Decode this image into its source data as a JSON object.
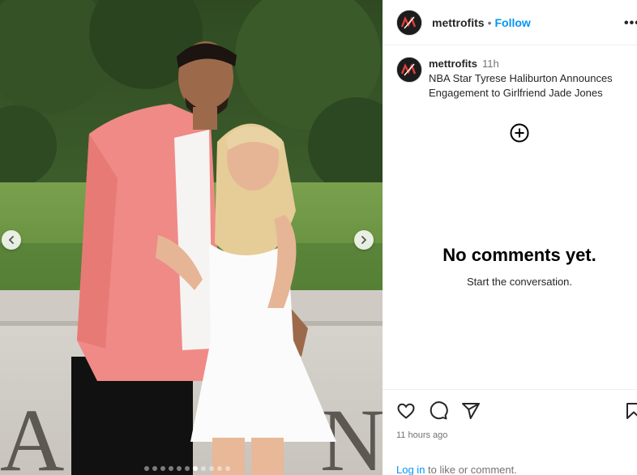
{
  "post": {
    "username": "mettrofits",
    "follow_label": "Follow",
    "separator": "•",
    "more_label": "•••"
  },
  "caption": {
    "username": "mettrofits",
    "time": "11h",
    "text": "NBA Star Tyrese Haliburton Announces Engagement to Girlfriend Jade Jones"
  },
  "comments": {
    "empty_title": "No comments yet.",
    "empty_subtitle": "Start the conversation."
  },
  "footer": {
    "timestamp": "11 hours ago",
    "login_link": "Log in",
    "login_suffix": " to like or comment."
  },
  "carousel": {
    "slide_count": 11,
    "active_index": 6
  },
  "icons": {
    "like": "heart-icon",
    "comment": "comment-icon",
    "share": "share-icon",
    "save": "bookmark-icon",
    "add": "plus-circle-icon",
    "prev": "chevron-left-icon",
    "next": "chevron-right-icon"
  },
  "colors": {
    "link": "#0095f6",
    "text": "#262626",
    "muted": "#737373"
  }
}
